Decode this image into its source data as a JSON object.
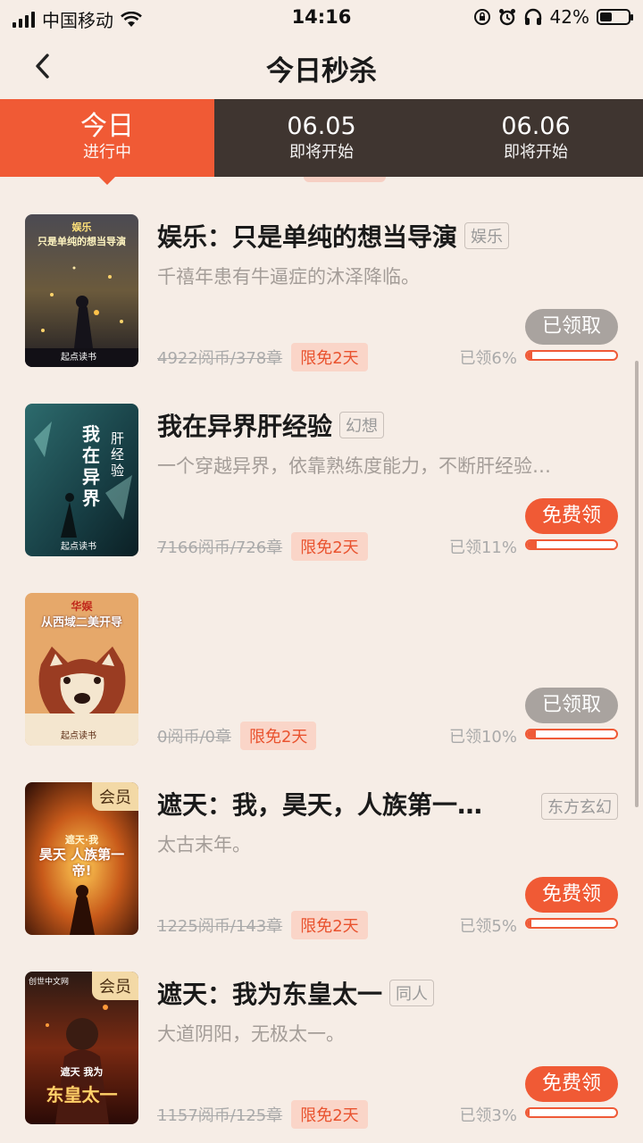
{
  "status": {
    "carrier": "中国移动",
    "time": "14:16",
    "battery": "42%",
    "battery_level": 0.42
  },
  "nav": {
    "title": "今日秒杀"
  },
  "tabs": [
    {
      "top": "今日",
      "bottom": "进行中"
    },
    {
      "top": "06.05",
      "bottom": "即将开始"
    },
    {
      "top": "06.06",
      "bottom": "即将开始"
    }
  ],
  "books": [
    {
      "title": "娱乐：只是单纯的想当导演",
      "genre": "娱乐",
      "desc": "千禧年患有牛逼症的沐泽降临。",
      "price": "4922阅币/378章",
      "limit": "限免2天",
      "action": "已领取",
      "claimed": "已领6%",
      "progress": 0.06,
      "vip": "",
      "cover_title_top": "娱乐",
      "cover_title_main": "只是单纯的想当导演",
      "cover_brand": "起点读书"
    },
    {
      "title": "我在异界肝经验",
      "genre": "幻想",
      "desc": "一个穿越异界，依靠熟练度能力，不断肝经验…",
      "price": "7166阅币/726章",
      "limit": "限免2天",
      "action": "免费领",
      "claimed": "已领11%",
      "progress": 0.11,
      "vip": "",
      "cover_title_top": "我在异界",
      "cover_title_main": "肝经验",
      "cover_brand": "起点读书"
    },
    {
      "title": "",
      "genre": "",
      "desc": "",
      "price": "0阅币/0章",
      "limit": "限免2天",
      "action": "已领取",
      "claimed": "已领10%",
      "progress": 0.1,
      "vip": "",
      "cover_title_top": "华娱",
      "cover_title_main": "从西域二美开导",
      "cover_brand": "起点读书"
    },
    {
      "title": "遮天：我，昊天，人族第一…",
      "genre": "东方玄幻",
      "desc": "太古末年。",
      "price": "1225阅币/143章",
      "limit": "限免2天",
      "action": "免费领",
      "claimed": "已领5%",
      "progress": 0.05,
      "vip": "会员",
      "cover_title_top": "遮天·我",
      "cover_title_main": "昊天 人族第一帝!",
      "cover_brand": ""
    },
    {
      "title": "遮天：我为东皇太一",
      "genre": "同人",
      "desc": "大道阴阳，无极太一。",
      "price": "1157阅币/125章",
      "limit": "限免2天",
      "action": "免费领",
      "claimed": "已领3%",
      "progress": 0.03,
      "vip": "会员",
      "cover_title_top": "遮天 我为",
      "cover_title_main": "东皇太一",
      "cover_brand": "创世中文网"
    }
  ]
}
